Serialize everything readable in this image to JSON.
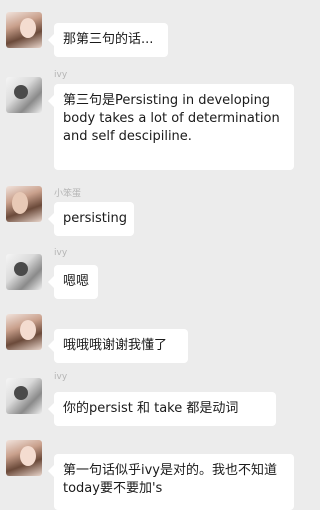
{
  "messages": [
    {
      "sender": "",
      "avatar": "girl-avatar",
      "text": "那第三句的话..."
    },
    {
      "sender": "ivy",
      "avatar": "ivy-avatar",
      "text": "第三句是Persisting in developing body takes a lot of determination and self descipiline."
    },
    {
      "sender": "小笨蛋",
      "avatar": "girl-avatar",
      "text": "persisting"
    },
    {
      "sender": "ivy",
      "avatar": "ivy-avatar",
      "text": "嗯嗯"
    },
    {
      "sender": "",
      "avatar": "girl-avatar",
      "text": "哦哦哦谢谢我懂了"
    },
    {
      "sender": "ivy",
      "avatar": "ivy-avatar",
      "text": "你的persist 和 take 都是动词"
    },
    {
      "sender": "",
      "avatar": "girl-avatar",
      "text": "第一句话似乎ivy是对的。我也不知道today要不要加's"
    }
  ]
}
